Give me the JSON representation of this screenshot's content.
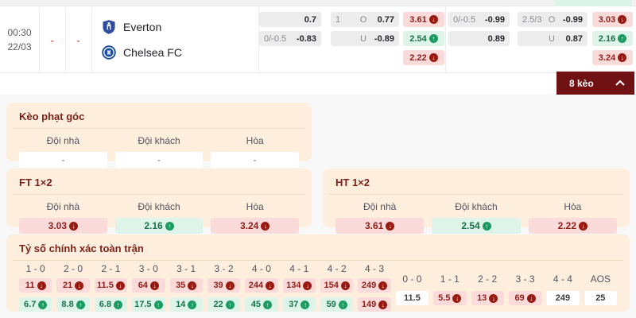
{
  "match": {
    "time": "00:30",
    "date": "22/03",
    "dash1": "-",
    "dash2": "-",
    "home_team": "Everton",
    "away_team": "Chelsea FC"
  },
  "odds_header": {
    "group1": {
      "hdp_row1": {
        "handicap": "",
        "value": "0.7"
      },
      "hdp_row2": {
        "handicap": "0/-0.5",
        "value": "-0.83"
      },
      "ou_row1": {
        "line": "1",
        "side": "O",
        "value": "0.77"
      },
      "ou_row2": {
        "line": "",
        "side": "U",
        "value": "-0.89"
      },
      "x12_row1": {
        "value": "3.61",
        "trend": "down"
      },
      "x12_row2": {
        "value": "2.54",
        "trend": "up"
      },
      "x12_row3": {
        "value": "2.22",
        "trend": "down"
      }
    },
    "group2": {
      "hdp_row1": {
        "handicap": "0/-0.5",
        "value": "-0.99"
      },
      "hdp_row2": {
        "handicap": "",
        "value": "0.89"
      },
      "ou_row1": {
        "line": "2.5/3",
        "side": "O",
        "value": "-0.99"
      },
      "ou_row2": {
        "line": "",
        "side": "U",
        "value": "0.87"
      },
      "x12_row1": {
        "value": "3.03",
        "trend": "down"
      },
      "x12_row2": {
        "value": "2.16",
        "trend": "up"
      },
      "x12_row3": {
        "value": "3.24",
        "trend": "down"
      }
    }
  },
  "keo_bar": {
    "label": "8 kèo"
  },
  "corner_section": {
    "title": "Kèo phạt góc",
    "col_home": "Đội nhà",
    "col_away": "Đội khách",
    "col_draw": "Hòa",
    "home": "-",
    "away": "-",
    "draw": "-"
  },
  "ft_section": {
    "title": "FT 1×2",
    "col_home": "Đội nhà",
    "col_away": "Đội khách",
    "col_draw": "Hòa",
    "home": "3.03",
    "away": "2.16",
    "draw": "3.24",
    "home_trend": "down",
    "away_trend": "up",
    "draw_trend": "down"
  },
  "ht_section": {
    "title": "HT 1×2",
    "col_home": "Đội nhà",
    "col_away": "Đội khách",
    "col_draw": "Hòa",
    "home": "3.61",
    "away": "2.54",
    "draw": "2.22",
    "home_trend": "down",
    "away_trend": "up",
    "draw_trend": "down"
  },
  "score_section": {
    "title": "Tỷ số chính xác toàn trận",
    "scores": [
      {
        "label": "1 - 0",
        "top": "11",
        "top_trend": "down",
        "bottom": "6.7",
        "bottom_trend": "up"
      },
      {
        "label": "2 - 0",
        "top": "21",
        "top_trend": "down",
        "bottom": "8.8",
        "bottom_trend": "up"
      },
      {
        "label": "2 - 1",
        "top": "11.5",
        "top_trend": "down",
        "bottom": "6.8",
        "bottom_trend": "up"
      },
      {
        "label": "3 - 0",
        "top": "64",
        "top_trend": "down",
        "bottom": "17.5",
        "bottom_trend": "up"
      },
      {
        "label": "3 - 1",
        "top": "35",
        "top_trend": "down",
        "bottom": "14",
        "bottom_trend": "up"
      },
      {
        "label": "3 - 2",
        "top": "39",
        "top_trend": "down",
        "bottom": "22",
        "bottom_trend": "up"
      },
      {
        "label": "4 - 0",
        "top": "244",
        "top_trend": "down",
        "bottom": "45",
        "bottom_trend": "up"
      },
      {
        "label": "4 - 1",
        "top": "134",
        "top_trend": "down",
        "bottom": "37",
        "bottom_trend": "up"
      },
      {
        "label": "4 - 2",
        "top": "154",
        "top_trend": "down",
        "bottom": "59",
        "bottom_trend": "up"
      },
      {
        "label": "4 - 3",
        "top": "249",
        "top_trend": "down",
        "bottom": "149",
        "bottom_trend": "down"
      }
    ],
    "draws": [
      {
        "label": "0 - 0",
        "value": "11.5",
        "trend": "none"
      },
      {
        "label": "1 - 1",
        "value": "5.5",
        "trend": "down"
      },
      {
        "label": "2 - 2",
        "value": "13",
        "trend": "down"
      },
      {
        "label": "3 - 3",
        "value": "69",
        "trend": "down"
      },
      {
        "label": "4 - 4",
        "value": "249",
        "trend": "none"
      },
      {
        "label": "AOS",
        "value": "25",
        "trend": "none"
      }
    ]
  },
  "colors": {
    "accent_dark_red": "#701114",
    "cell_pink": "#fbdbd9",
    "cell_green": "#def4e9",
    "card_bg": "#fdeede",
    "trend_down": "#98190f",
    "trend_up": "#1b9a62"
  }
}
